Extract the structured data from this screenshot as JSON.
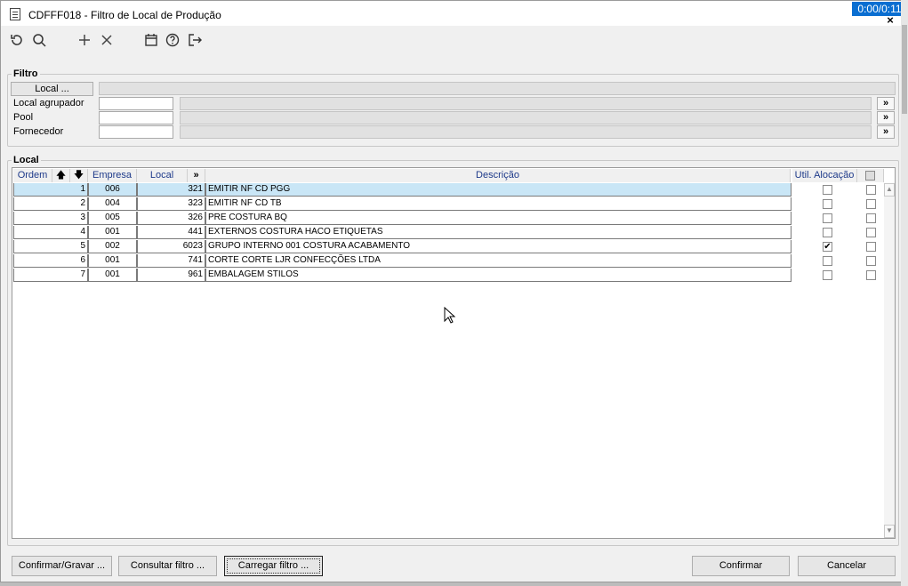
{
  "window": {
    "title": "CDFFF018 - Filtro de Local de Produção",
    "timer": "0:00/0:11",
    "close_label": "×"
  },
  "toolbar": {
    "icons": [
      "refresh-icon",
      "search-icon",
      "add-icon",
      "delete-icon",
      "calendar-icon",
      "help-icon",
      "exit-icon"
    ]
  },
  "filtro": {
    "label": "Filtro",
    "local_button": "Local ...",
    "local_agrupador": "Local agrupador",
    "pool": "Pool",
    "fornecedor": "Fornecedor",
    "more": "»"
  },
  "local_group": {
    "label": "Local"
  },
  "grid": {
    "headers": {
      "ordem": "Ordem",
      "up": "🡅",
      "down": "🡇",
      "empresa": "Empresa",
      "local": "Local",
      "more": "»",
      "descricao": "Descrição",
      "util": "Util. Alocação"
    },
    "rows": [
      {
        "ordem": "1",
        "empresa": "006",
        "local": "321",
        "descricao": "EMITIR NF CD PGG",
        "util": false,
        "sel": false
      },
      {
        "ordem": "2",
        "empresa": "004",
        "local": "323",
        "descricao": "EMITIR NF CD TB",
        "util": false,
        "sel": false
      },
      {
        "ordem": "3",
        "empresa": "005",
        "local": "326",
        "descricao": "PRE COSTURA BQ",
        "util": false,
        "sel": false
      },
      {
        "ordem": "4",
        "empresa": "001",
        "local": "441",
        "descricao": "EXTERNOS COSTURA HACO ETIQUETAS",
        "util": false,
        "sel": false
      },
      {
        "ordem": "5",
        "empresa": "002",
        "local": "6023",
        "descricao": "GRUPO INTERNO 001 COSTURA ACABAMENTO",
        "util": true,
        "sel": false
      },
      {
        "ordem": "6",
        "empresa": "001",
        "local": "741",
        "descricao": "CORTE CORTE LJR CONFECÇÕES LTDA",
        "util": false,
        "sel": false
      },
      {
        "ordem": "7",
        "empresa": "001",
        "local": "961",
        "descricao": " EMBALAGEM  STILOS",
        "util": false,
        "sel": false
      }
    ]
  },
  "footer": {
    "confirmar_gravar": "Confirmar/Gravar ...",
    "consultar_filtro": "Consultar filtro ...",
    "carregar_filtro": "Carregar filtro ...",
    "confirmar": "Confirmar",
    "cancelar": "Cancelar"
  }
}
